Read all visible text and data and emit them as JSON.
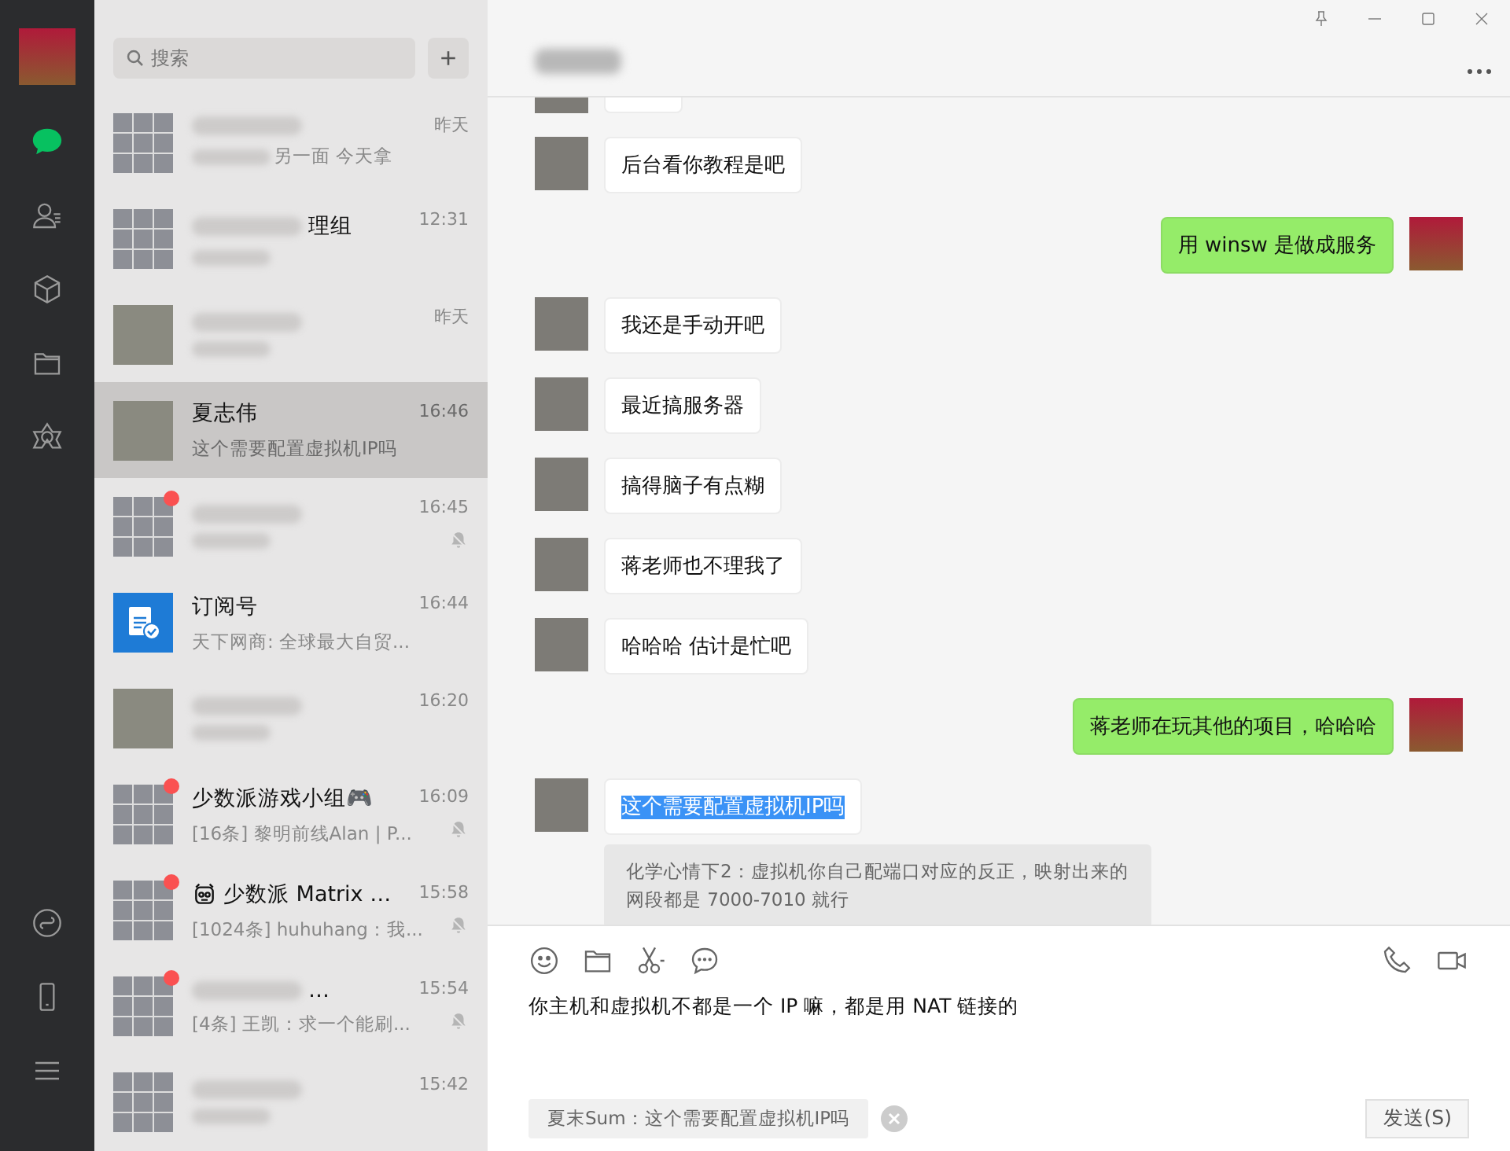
{
  "sidebar": {
    "items": [
      {
        "selected": true
      },
      {
        "selected": false
      },
      {
        "selected": false
      },
      {
        "selected": false
      },
      {
        "selected": false
      }
    ]
  },
  "search": {
    "placeholder": "搜索",
    "add_button": "+"
  },
  "chats": [
    {
      "kind": "grid",
      "preview_tail": "另一面 今天拿",
      "time": "昨天",
      "unread": false,
      "muted": false,
      "selected": false
    },
    {
      "kind": "grid",
      "name_tail": "理组",
      "time": "12:31",
      "unread": false,
      "muted": false,
      "selected": false
    },
    {
      "kind": "photo",
      "time": "昨天",
      "unread": false,
      "muted": false,
      "selected": false
    },
    {
      "kind": "photo",
      "name": "夏志伟",
      "preview": "这个需要配置虚拟机IP吗",
      "time": "16:46",
      "unread": false,
      "muted": false,
      "selected": true
    },
    {
      "kind": "grid",
      "time": "16:45",
      "unread": true,
      "muted": true,
      "selected": false
    },
    {
      "kind": "subscription",
      "name": "订阅号",
      "preview": "天下网商: 全球最大自贸...",
      "time": "16:44",
      "unread": false,
      "muted": false,
      "selected": false
    },
    {
      "kind": "photo",
      "time": "16:20",
      "unread": false,
      "muted": false,
      "selected": false
    },
    {
      "kind": "grid",
      "name": "少数派游戏小组🎮",
      "preview": "[16条] 黎明前线Alan | P...",
      "time": "16:09",
      "unread": true,
      "muted": true,
      "selected": false
    },
    {
      "kind": "grid",
      "name_icon": true,
      "name": "少数派 Matrix  …",
      "preview": "[1024条] huhuhang：我...",
      "time": "15:58",
      "unread": true,
      "muted": true,
      "selected": false
    },
    {
      "kind": "grid",
      "name_tail": "…",
      "preview": "[4条] 王凯：求一个能刷...",
      "time": "15:54",
      "unread": true,
      "muted": true,
      "selected": false
    },
    {
      "kind": "grid",
      "time": "15:42",
      "unread": false,
      "muted": false,
      "selected": false
    }
  ],
  "conversation": {
    "messages": [
      {
        "kind": "bubble",
        "outgoing": false
      },
      {
        "kind": "bubble",
        "outgoing": false,
        "text": "后台看你教程是吧",
        "selected": false
      },
      {
        "kind": "bubble",
        "outgoing": true,
        "text": "用 winsw 是做成服务",
        "selected": false
      },
      {
        "kind": "bubble",
        "outgoing": false,
        "text": "我还是手动开吧",
        "selected": false
      },
      {
        "kind": "bubble",
        "outgoing": false,
        "text": "最近搞服务器",
        "selected": false
      },
      {
        "kind": "bubble",
        "outgoing": false,
        "text": "搞得脑子有点糊",
        "selected": false
      },
      {
        "kind": "bubble",
        "outgoing": false,
        "text": "蒋老师也不理我了",
        "selected": false
      },
      {
        "kind": "bubble",
        "outgoing": false,
        "text": "哈哈哈 估计是忙吧",
        "selected": false
      },
      {
        "kind": "bubble",
        "outgoing": true,
        "text": "蒋老师在玩其他的项目，哈哈哈",
        "selected": false
      },
      {
        "kind": "bubble",
        "outgoing": false,
        "text": "这个需要配置虚拟机IP吗",
        "selected": true
      },
      {
        "kind": "quote",
        "text": "化学心情下2：虚拟机你自己配端口对应的反正，映射出来的网段都是 7000-7010 就行"
      }
    ],
    "input": {
      "value": "你主机和虚拟机不都是一个 IP 嘛，都是用 NAT 链接的"
    },
    "reply_quote": "夏末Sum：这个需要配置虚拟机IP吗",
    "send_button": "发送(S)"
  }
}
